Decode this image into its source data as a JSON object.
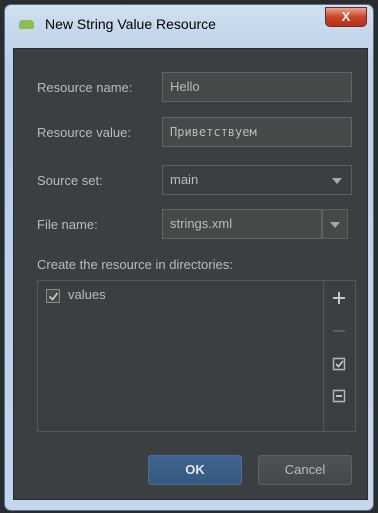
{
  "window": {
    "title": "New String Value Resource",
    "close_glyph": "X"
  },
  "form": {
    "resource_name_label": "Resource name:",
    "resource_name_value": "Hello",
    "resource_value_label": "Resource value:",
    "resource_value_value": "Приветствуем",
    "source_set_label": "Source set:",
    "source_set_value": "main",
    "file_name_label": "File name:",
    "file_name_value": "strings.xml",
    "directories_label": "Create the resource in directories:"
  },
  "directories": {
    "items": [
      {
        "label": "values",
        "checked": true
      }
    ],
    "toolbar_icons": [
      "plus-icon",
      "minus-icon",
      "check-all-icon",
      "collapse-icon"
    ]
  },
  "buttons": {
    "ok": "OK",
    "cancel": "Cancel"
  },
  "colors": {
    "accent": "#365880",
    "background": "#3c3f41",
    "text": "#bbbbbb"
  }
}
